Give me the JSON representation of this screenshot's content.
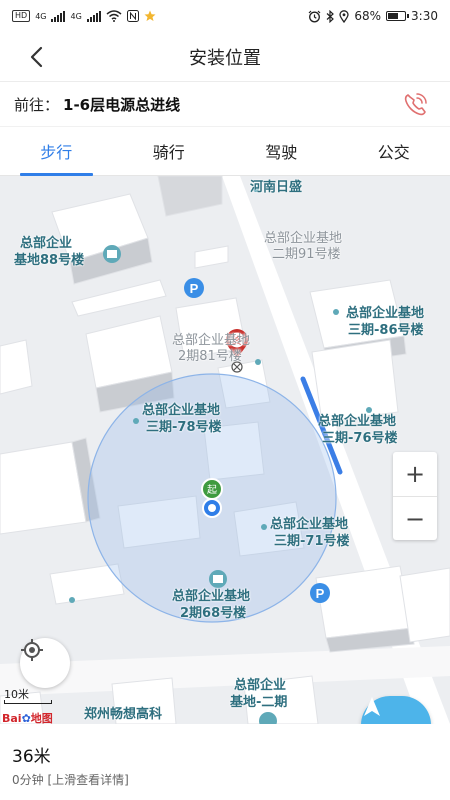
{
  "status_bar": {
    "left_badges": [
      "HD",
      "4G",
      "4G"
    ],
    "battery_percent": "68%",
    "battery_level": 0.68,
    "time": "3:30"
  },
  "header": {
    "title": "安装位置"
  },
  "destination": {
    "prefix": "前往：",
    "name": "1-6层电源总进线"
  },
  "tabs": [
    {
      "label": "步行",
      "active": true
    },
    {
      "label": "骑行",
      "active": false
    },
    {
      "label": "驾驶",
      "active": false
    },
    {
      "label": "公交",
      "active": false
    }
  ],
  "map": {
    "labels": {
      "henan_risheng": "河南日盛",
      "b88_l1": "总部企业",
      "b88_l2": "基地88号楼",
      "b91_l1": "总部企业基地",
      "b91_l2": "二期91号楼",
      "b86_l1": "总部企业基地",
      "b86_l2": "三期-86号楼",
      "b81_l1": "总部企业基地",
      "b81_l2": "2期81号楼",
      "b78_l1": "总部企业基地",
      "b78_l2": "三期-78号楼",
      "b76_l1": "总部企业基地",
      "b76_l2": "三期-76号楼",
      "b71_l1": "总部企业基地",
      "b71_l2": "三期-71号楼",
      "b68_l1": "总部企业基地",
      "b68_l2": "2期68号楼",
      "bphase2_l1": "总部企业",
      "bphase2_l2": "基地-二期",
      "zhengzhou": "郑州畅想高科"
    },
    "start_marker": "起",
    "end_marker": "终",
    "zoom_in": "+",
    "zoom_out": "−",
    "scale_label": "10米",
    "logo_text": "Bai",
    "logo_text2": "地图",
    "colors": {
      "route": "#3b7ee6",
      "accuracy_circle": "#8db4e8",
      "end_marker": "#c9302c",
      "start_marker": "#3f9b3f",
      "nav_button": "#4db4ea"
    }
  },
  "route_info": {
    "distance": "36米",
    "duration": "0分钟 [上滑查看详情]"
  }
}
